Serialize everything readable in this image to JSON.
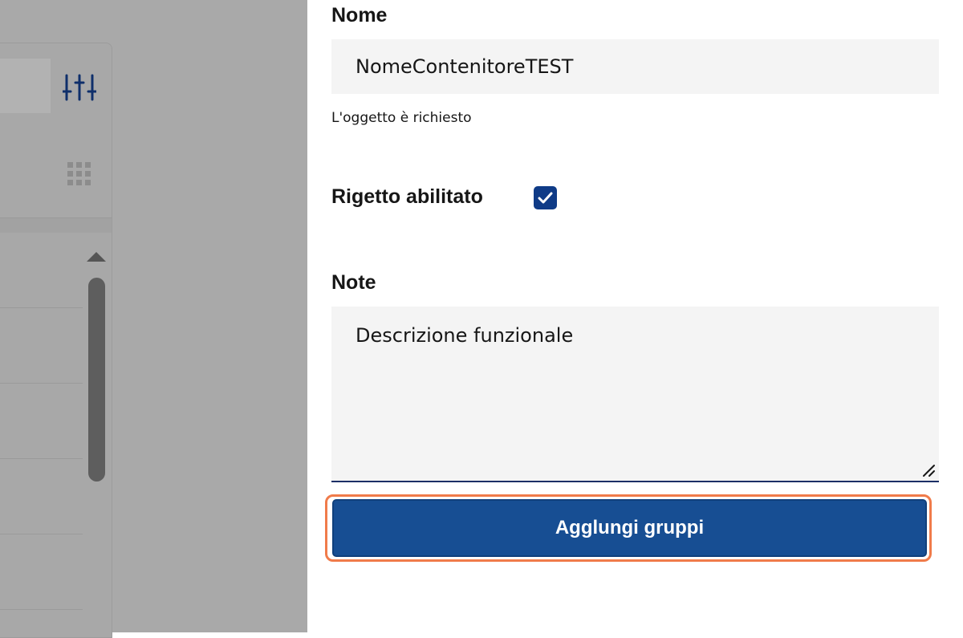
{
  "background": {
    "filter_icon": "sliders-icon",
    "grid_icon": "grid-dots-icon",
    "scroll_up_icon": "caret-up-icon"
  },
  "panel": {
    "name_label": "Nome",
    "name_value": "NomeContenitoreTEST",
    "name_helper": "L'oggetto è richiesto",
    "rejection_label": "Rigetto abilitato",
    "rejection_checked": true,
    "notes_label": "Note",
    "notes_value": "Descrizione funzionale",
    "submit_label": "Agglungi gruppi"
  },
  "colors": {
    "accent": "#174e93",
    "checkbox": "#0f3b87",
    "focus_ring": "#f07b4a",
    "overlay": "#a9a9a9"
  }
}
